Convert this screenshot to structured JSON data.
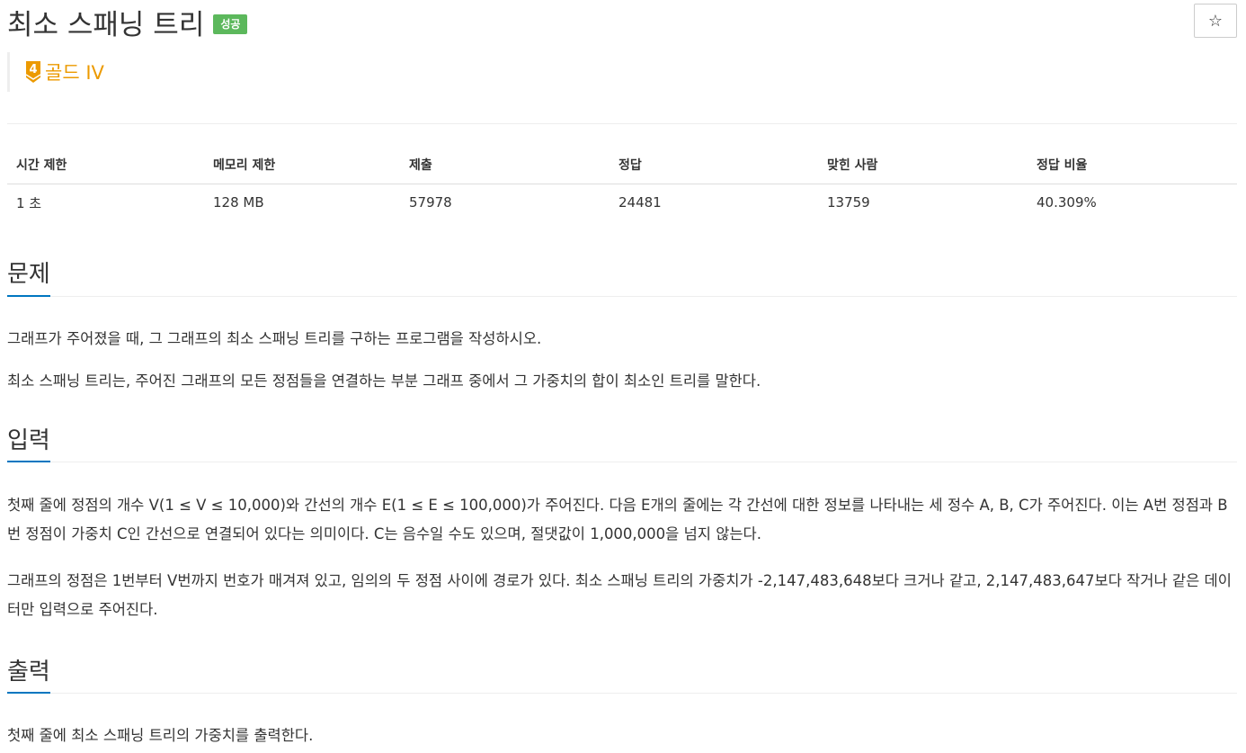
{
  "header": {
    "title": "최소 스패닝 트리",
    "status_badge": "성공",
    "star_label": "☆"
  },
  "tier": {
    "level": "4",
    "label": "골드 IV",
    "color": "#ec9a00"
  },
  "info_table": {
    "headers": [
      "시간 제한",
      "메모리 제한",
      "제출",
      "정답",
      "맞힌 사람",
      "정답 비율"
    ],
    "values": [
      "1 초",
      "128 MB",
      "57978",
      "24481",
      "13759",
      "40.309%"
    ]
  },
  "sections": {
    "problem": {
      "heading": "문제",
      "paragraphs": [
        "그래프가 주어졌을 때, 그 그래프의 최소 스패닝 트리를 구하는 프로그램을 작성하시오.",
        "최소 스패닝 트리는, 주어진 그래프의 모든 정점들을 연결하는 부분 그래프 중에서 그 가중치의 합이 최소인 트리를 말한다."
      ]
    },
    "input": {
      "heading": "입력",
      "paragraphs": [
        "첫째 줄에 정점의 개수 V(1 ≤ V ≤ 10,000)와 간선의 개수 E(1 ≤ E ≤ 100,000)가 주어진다. 다음 E개의 줄에는 각 간선에 대한 정보를 나타내는 세 정수 A, B, C가 주어진다. 이는 A번 정점과 B번 정점이 가중치 C인 간선으로 연결되어 있다는 의미이다. C는 음수일 수도 있으며, 절댓값이 1,000,000을 넘지 않는다.",
        "그래프의 정점은 1번부터 V번까지 번호가 매겨져 있고, 임의의 두 정점 사이에 경로가 있다. 최소 스패닝 트리의 가중치가 -2,147,483,648보다 크거나 같고, 2,147,483,647보다 작거나 같은 데이터만 입력으로 주어진다."
      ]
    },
    "output": {
      "heading": "출력",
      "paragraphs": [
        "첫째 줄에 최소 스패닝 트리의 가중치를 출력한다."
      ]
    }
  },
  "colors": {
    "accent": "#0076c0",
    "success": "#5cb85c",
    "gold": "#ec9a00"
  }
}
